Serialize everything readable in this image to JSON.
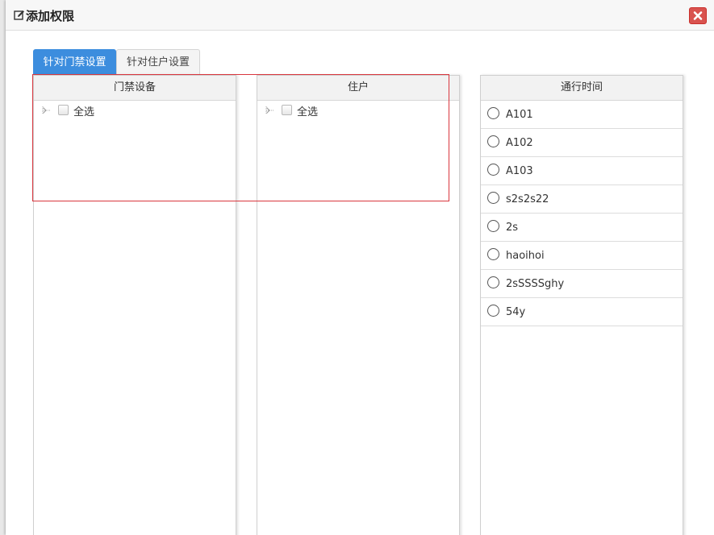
{
  "dialog": {
    "title": "添加权限",
    "title_icon": "edit-icon",
    "close_icon": "close-icon",
    "close_color": "#d9534f"
  },
  "tabs": [
    {
      "label": "针对门禁设置",
      "active": true
    },
    {
      "label": "针对住户设置",
      "active": false
    }
  ],
  "panels": {
    "devices": {
      "header": "门禁设备",
      "select_all_label": "全选"
    },
    "residents": {
      "header": "住户",
      "select_all_label": "全选"
    },
    "times": {
      "header": "通行时间",
      "items": [
        "A101",
        "A102",
        "A103",
        "s2s2s22",
        "2s",
        "haoihoi",
        "2sSSSSghy",
        "54y"
      ]
    }
  },
  "colors": {
    "tab_active": "#3c8dde",
    "selection_outline": "#d9363e"
  }
}
